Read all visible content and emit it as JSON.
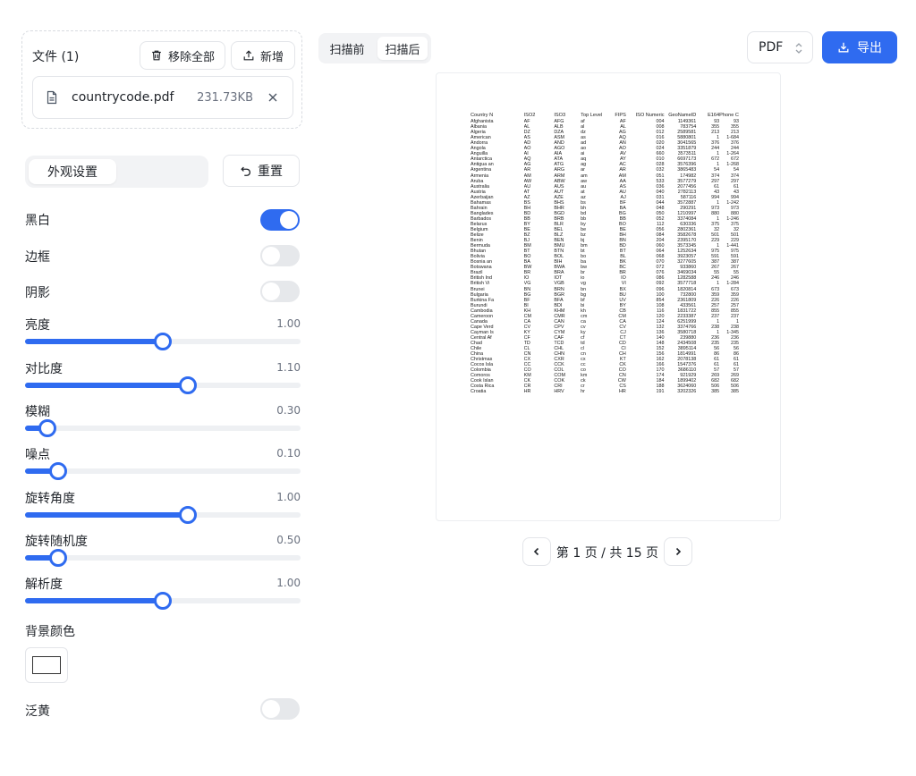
{
  "files": {
    "title": "文件 (1)",
    "clear_label": "移除全部",
    "add_label": "新增",
    "items": [
      {
        "name": "countrycode.pdf",
        "size": "231.73KB"
      }
    ]
  },
  "appearance": {
    "tab_label": "外观设置",
    "reset_label": "重置"
  },
  "toggles": [
    {
      "label": "黑白",
      "on": true
    },
    {
      "label": "边框",
      "on": false
    },
    {
      "label": "阴影",
      "on": false
    }
  ],
  "sliders": [
    {
      "label": "亮度",
      "value": "1.00",
      "fraction": 0.5
    },
    {
      "label": "对比度",
      "value": "1.10",
      "fraction": 0.59
    },
    {
      "label": "模糊",
      "value": "0.30",
      "fraction": 0.08
    },
    {
      "label": "噪点",
      "value": "0.10",
      "fraction": 0.12
    },
    {
      "label": "旋转角度",
      "value": "1.00",
      "fraction": 0.59
    },
    {
      "label": "旋转随机度",
      "value": "0.50",
      "fraction": 0.12
    },
    {
      "label": "解析度",
      "value": "1.00",
      "fraction": 0.5
    }
  ],
  "bg_color_label": "背景颜色",
  "bg_color": "#ffffff",
  "yellowing": {
    "label": "泛黄",
    "on": false
  },
  "view_tabs": [
    "扫描前",
    "扫描后"
  ],
  "format": {
    "value": "PDF"
  },
  "export_label": "导出",
  "document": {
    "headers": [
      "Country N",
      "ISO2",
      "ISO3",
      "Top Level",
      "FIPS",
      "ISO Numeric",
      "GeoNameID",
      "E164",
      "Phone Code"
    ],
    "rows": [
      [
        "Afghanista",
        "AF",
        "AFG",
        "af",
        "AF",
        "004",
        "1149361",
        "93",
        "93"
      ],
      [
        "Albania",
        "AL",
        "ALB",
        "al",
        "AL",
        "008",
        "783754",
        "355",
        "355"
      ],
      [
        "Algeria",
        "DZ",
        "DZA",
        "dz",
        "AG",
        "012",
        "2589581",
        "213",
        "213"
      ],
      [
        "American",
        "AS",
        "ASM",
        "as",
        "AQ",
        "016",
        "5880801",
        "1",
        "1-684"
      ],
      [
        "Andorra",
        "AD",
        "AND",
        "ad",
        "AN",
        "020",
        "3041565",
        "376",
        "376"
      ],
      [
        "Angola",
        "AO",
        "AGO",
        "ao",
        "AO",
        "024",
        "3351879",
        "244",
        "244"
      ],
      [
        "Anguilla",
        "AI",
        "AIA",
        "ai",
        "AV",
        "660",
        "3573511",
        "1",
        "1-264"
      ],
      [
        "Antarctica",
        "AQ",
        "ATA",
        "aq",
        "AY",
        "010",
        "6697173",
        "672",
        "672"
      ],
      [
        "Antigua an",
        "AG",
        "ATG",
        "ag",
        "AC",
        "028",
        "3576396",
        "1",
        "1-268"
      ],
      [
        "Argentina",
        "AR",
        "ARG",
        "ar",
        "AR",
        "032",
        "3865483",
        "54",
        "54"
      ],
      [
        "Armenia",
        "AM",
        "ARM",
        "am",
        "AM",
        "051",
        "174982",
        "374",
        "374"
      ],
      [
        "Aruba",
        "AW",
        "ABW",
        "aw",
        "AA",
        "533",
        "3577279",
        "297",
        "297"
      ],
      [
        "Australia",
        "AU",
        "AUS",
        "au",
        "AS",
        "036",
        "2077456",
        "61",
        "61"
      ],
      [
        "Austria",
        "AT",
        "AUT",
        "at",
        "AU",
        "040",
        "2782113",
        "43",
        "43"
      ],
      [
        "Azerbaijan",
        "AZ",
        "AZE",
        "az",
        "AJ",
        "031",
        "587116",
        "994",
        "994"
      ],
      [
        "Bahamas",
        "BS",
        "BHS",
        "bs",
        "BF",
        "044",
        "3572887",
        "1",
        "1-242"
      ],
      [
        "Bahrain",
        "BH",
        "BHR",
        "bh",
        "BA",
        "048",
        "290291",
        "973",
        "973"
      ],
      [
        "Banglades",
        "BD",
        "BGD",
        "bd",
        "BG",
        "050",
        "1210997",
        "880",
        "880"
      ],
      [
        "Barbados",
        "BB",
        "BRB",
        "bb",
        "BB",
        "052",
        "3374084",
        "1",
        "1-246"
      ],
      [
        "Belarus",
        "BY",
        "BLR",
        "by",
        "BO",
        "112",
        "630336",
        "375",
        "375"
      ],
      [
        "Belgium",
        "BE",
        "BEL",
        "be",
        "BE",
        "056",
        "2802361",
        "32",
        "32"
      ],
      [
        "Belize",
        "BZ",
        "BLZ",
        "bz",
        "BH",
        "084",
        "3582678",
        "501",
        "501"
      ],
      [
        "Benin",
        "BJ",
        "BEN",
        "bj",
        "BN",
        "204",
        "2395170",
        "229",
        "229"
      ],
      [
        "Bermuda",
        "BM",
        "BMU",
        "bm",
        "BD",
        "060",
        "3573345",
        "1",
        "1-441"
      ],
      [
        "Bhutan",
        "BT",
        "BTN",
        "bt",
        "BT",
        "064",
        "1252634",
        "975",
        "975"
      ],
      [
        "Bolivia",
        "BO",
        "BOL",
        "bo",
        "BL",
        "068",
        "3923057",
        "591",
        "591"
      ],
      [
        "Bosnia an",
        "BA",
        "BIH",
        "ba",
        "BK",
        "070",
        "3277605",
        "387",
        "387"
      ],
      [
        "Botswana",
        "BW",
        "BWA",
        "bw",
        "BC",
        "072",
        "933860",
        "267",
        "267"
      ],
      [
        "Brazil",
        "BR",
        "BRA",
        "br",
        "BR",
        "076",
        "3469034",
        "55",
        "55"
      ],
      [
        "British Ind",
        "IO",
        "IOT",
        "io",
        "IO",
        "086",
        "1282588",
        "246",
        "246"
      ],
      [
        "British Vi",
        "VG",
        "VGB",
        "vg",
        "VI",
        "092",
        "3577718",
        "1",
        "1-284"
      ],
      [
        "Brunei",
        "BN",
        "BRN",
        "bn",
        "BX",
        "096",
        "1820814",
        "673",
        "673"
      ],
      [
        "Bulgaria",
        "BG",
        "BGR",
        "bg",
        "BU",
        "100",
        "732800",
        "359",
        "359"
      ],
      [
        "Burkina Fa",
        "BF",
        "BFA",
        "bf",
        "UV",
        "854",
        "2361809",
        "226",
        "226"
      ],
      [
        "Burundi",
        "BI",
        "BDI",
        "bi",
        "BY",
        "108",
        "433561",
        "257",
        "257"
      ],
      [
        "Cambodia",
        "KH",
        "KHM",
        "kh",
        "CB",
        "116",
        "1831722",
        "855",
        "855"
      ],
      [
        "Cameroon",
        "CM",
        "CMR",
        "cm",
        "CM",
        "120",
        "2233387",
        "237",
        "237"
      ],
      [
        "Canada",
        "CA",
        "CAN",
        "ca",
        "CA",
        "124",
        "6251999",
        "1",
        "1"
      ],
      [
        "Cape Verd",
        "CV",
        "CPV",
        "cv",
        "CV",
        "132",
        "3374766",
        "238",
        "238"
      ],
      [
        "Cayman Is",
        "KY",
        "CYM",
        "ky",
        "CJ",
        "136",
        "3580718",
        "1",
        "1-345"
      ],
      [
        "Central Af",
        "CF",
        "CAF",
        "cf",
        "CT",
        "140",
        "239880",
        "236",
        "236"
      ],
      [
        "Chad",
        "TD",
        "TCD",
        "td",
        "CD",
        "148",
        "2434508",
        "235",
        "235"
      ],
      [
        "Chile",
        "CL",
        "CHL",
        "cl",
        "CI",
        "152",
        "3895114",
        "56",
        "56"
      ],
      [
        "China",
        "CN",
        "CHN",
        "cn",
        "CH",
        "156",
        "1814991",
        "86",
        "86"
      ],
      [
        "Christmas",
        "CX",
        "CXR",
        "cx",
        "KT",
        "162",
        "2078138",
        "61",
        "61"
      ],
      [
        "Cocos Isla",
        "CC",
        "CCK",
        "cc",
        "CK",
        "166",
        "1547376",
        "61",
        "61"
      ],
      [
        "Colombia",
        "CO",
        "COL",
        "co",
        "CO",
        "170",
        "3686110",
        "57",
        "57"
      ],
      [
        "Comoros",
        "KM",
        "COM",
        "km",
        "CN",
        "174",
        "921929",
        "269",
        "269"
      ],
      [
        "Cook Islan",
        "CK",
        "COK",
        "ck",
        "CW",
        "184",
        "1899402",
        "682",
        "682"
      ],
      [
        "Costa Rica",
        "CR",
        "CRI",
        "cr",
        "CS",
        "188",
        "3624060",
        "506",
        "506"
      ],
      [
        "Croatia",
        "HR",
        "HRV",
        "hr",
        "HR",
        "191",
        "3202326",
        "385",
        "385"
      ]
    ]
  },
  "pager": {
    "text": "第 1 页 / 共 15 页"
  }
}
